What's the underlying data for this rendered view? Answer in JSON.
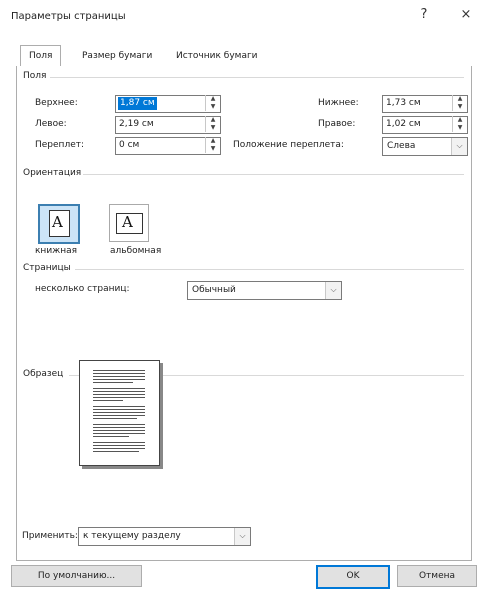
{
  "window": {
    "title": "Параметры страницы",
    "help_icon": "?",
    "close_icon": "×"
  },
  "tabs": [
    {
      "label": "Поля",
      "active": true
    },
    {
      "label": "Размер бумаги",
      "active": false
    },
    {
      "label": "Источник бумаги",
      "active": false
    }
  ],
  "margins": {
    "section_label": "Поля",
    "top_label": "Верхнее:",
    "top_value": "1,87 см",
    "bottom_label": "Нижнее:",
    "bottom_value": "1,73 см",
    "left_label": "Левое:",
    "left_value": "2,19 см",
    "right_label": "Правое:",
    "right_value": "1,02 см",
    "gutter_label": "Переплет:",
    "gutter_value": "0 см",
    "gutter_pos_label": "Положение переплета:",
    "gutter_pos_value": "Слева"
  },
  "orientation": {
    "section_label": "Ориентация",
    "portrait_label": "книжная",
    "landscape_label": "альбомная",
    "icon_letter": "A"
  },
  "pages": {
    "section_label": "Страницы",
    "multiple_label": "несколько страниц:",
    "multiple_value": "Обычный"
  },
  "preview": {
    "section_label": "Образец"
  },
  "apply": {
    "label": "Применить:",
    "value": "к текущему разделу"
  },
  "buttons": {
    "default": "По умолчанию...",
    "ok": "OK",
    "cancel": "Отмена"
  },
  "icons": {
    "spin_up": "▲",
    "spin_down": "▼",
    "dropdown": "⌵"
  }
}
